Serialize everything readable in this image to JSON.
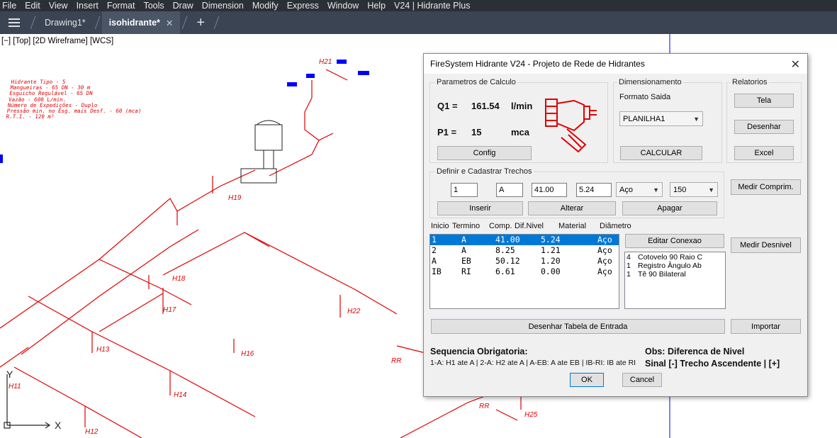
{
  "menu": [
    "File",
    "Edit",
    "View",
    "Insert",
    "Format",
    "Tools",
    "Draw",
    "Dimension",
    "Modify",
    "Express",
    "Window",
    "Help",
    "V24 | Hidrante Plus"
  ],
  "tabs": [
    {
      "label": "Drawing1*",
      "active": false
    },
    {
      "label": "isohidrante*",
      "active": true,
      "close": "✕"
    }
  ],
  "tab_add": "+",
  "viewport": {
    "label": "[−] [Top] [2D Wireframe] [WCS]",
    "notes": [
      "Hidrante Tipo - 5",
      "Mangueiras - 65 DN - 30 m",
      "Esguicho Regulável - 65 DN",
      "Vazão - 600 L/min.",
      "Número de Expedições - Duplo",
      "Pressão min. no Esg. mais Desf. - 60 (mca)",
      "R.T.I. - 120 m³"
    ],
    "nodes": [
      "H21",
      "H19",
      "H18",
      "H17",
      "H22",
      "H13",
      "H16",
      "H14",
      "H11",
      "H12",
      "H25",
      "RR",
      "RR"
    ],
    "ucs": {
      "x": "X",
      "y": "Y"
    }
  },
  "dialog": {
    "title": "FireSystem Hidrante V24 - Projeto de Rede de Hidrantes",
    "close": "✕",
    "calc": {
      "group": "Parametros de Calculo",
      "q1_label": "Q1 =",
      "q1_value": "161.54",
      "q1_unit": "l/min",
      "p1_label": "P1 =",
      "p1_value": "15",
      "p1_unit": "mca",
      "config_btn": "Config"
    },
    "dim": {
      "group": "Dimensionamento",
      "format_label": "Formato Saida",
      "format_value": "PLANILHA1",
      "calc_btn": "CALCULAR"
    },
    "reports": {
      "group": "Relatorios",
      "tela_btn": "Tela",
      "desenhar_btn": "Desenhar",
      "excel_btn": "Excel"
    },
    "trechos": {
      "group": "Definir e Cadastrar Trechos",
      "f_inicio": "1",
      "f_termino": "A",
      "f_comp": "41.00",
      "f_dif": "5.24",
      "material": "Aço",
      "diametro": "150",
      "inserir_btn": "Inserir",
      "alterar_btn": "Alterar",
      "apagar_btn": "Apagar"
    },
    "medir_comp_btn": "Medir Comprim.",
    "medir_desnivel_btn": "Medir Desnivel",
    "columns": [
      "Inicio",
      "Termino",
      "Comp.",
      "Dif.Nivel",
      "Material",
      "Diâmetro"
    ],
    "rows": [
      {
        "inicio": "1",
        "termino": "A",
        "comp": "41.00",
        "dif": "5.24",
        "material": "Aço",
        "selected": true
      },
      {
        "inicio": "2",
        "termino": "A",
        "comp": "8.25",
        "dif": "1.21",
        "material": "Aço",
        "selected": false
      },
      {
        "inicio": "A",
        "termino": "EB",
        "comp": "50.12",
        "dif": "1.20",
        "material": "Aço",
        "selected": false
      },
      {
        "inicio": "IB",
        "termino": "RI",
        "comp": "6.61",
        "dif": "0.00",
        "material": "Aço",
        "selected": false
      }
    ],
    "editar_conexao_btn": "Editar Conexao",
    "conexoes": [
      {
        "qty": "4",
        "name": "Cotovelo 90 Raio C"
      },
      {
        "qty": "1",
        "name": "Registro Ângulo Ab"
      },
      {
        "qty": "1",
        "name": "Tê 90 Bilateral"
      }
    ],
    "desenhar_tabela_btn": "Desenhar Tabela de Entrada",
    "importar_btn": "Importar",
    "seq_title": "Sequencia Obrigatoria:",
    "seq_text": "1-A: H1 ate A | 2-A: H2 ate A | A-EB: A ate EB | IB-RI: IB ate RI",
    "obs_title": "Obs: Diferenca de Nivel",
    "obs_text": "Sinal [-] Trecho Ascendente | [+]",
    "ok_btn": "OK",
    "cancel_btn": "Cancel"
  },
  "colors": {
    "pipe": "#e00000",
    "menubar": "#2b2f36",
    "tabbar": "#3b4453",
    "selection": "#0078d7"
  }
}
